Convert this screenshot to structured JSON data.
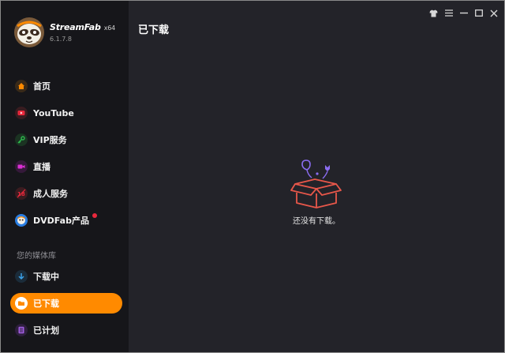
{
  "app": {
    "name": "StreamFab",
    "arch": "x64",
    "version": "6.1.7.8"
  },
  "sidebar": {
    "items": [
      {
        "label": "首页",
        "icon": "home-icon",
        "color": "#ff8a00"
      },
      {
        "label": "YouTube",
        "icon": "youtube-icon",
        "color": "#e8283c"
      },
      {
        "label": "VIP服务",
        "icon": "key-icon",
        "color": "#2db84d"
      },
      {
        "label": "直播",
        "icon": "camera-icon",
        "color": "#d92fd2"
      },
      {
        "label": "成人服务",
        "icon": "adult-18-icon",
        "color": "#e8283c"
      },
      {
        "label": "DVDFab产品",
        "icon": "dvdfab-icon",
        "color": "#2a7de1"
      }
    ],
    "library_title": "您的媒体库",
    "library": [
      {
        "label": "下载中",
        "icon": "download-arrow-icon",
        "color": "#3aa0e8"
      },
      {
        "label": "已下载",
        "icon": "folder-icon",
        "color": "#ff8a00",
        "active": true
      },
      {
        "label": "已计划",
        "icon": "list-icon",
        "color": "#a05ee0"
      }
    ]
  },
  "main": {
    "title": "已下载",
    "empty_text": "还没有下载。"
  },
  "colors": {
    "accent": "#ff8a00",
    "sidebar_bg": "#16161a",
    "main_bg": "#232329",
    "notification_dot": "#e8283c"
  }
}
